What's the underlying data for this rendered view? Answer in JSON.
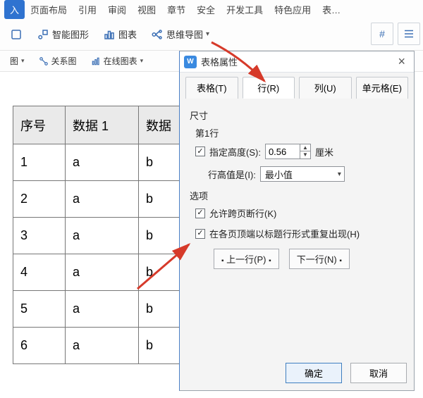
{
  "menubar": {
    "items": [
      "入",
      "页面布局",
      "引用",
      "审阅",
      "视图",
      "章节",
      "安全",
      "开发工具",
      "特色应用",
      "表…"
    ]
  },
  "ribbon": {
    "shapes": "智能图形",
    "chart": "图表",
    "mindmap": "思维导图"
  },
  "ribbon2": {
    "flow": "图",
    "relation": "关系图",
    "onlinechart": "在线图表"
  },
  "table": {
    "headers": [
      "序号",
      "数据 1",
      "数据"
    ],
    "rows": [
      {
        "n": "1",
        "d1": "a",
        "d2": "b"
      },
      {
        "n": "2",
        "d1": "a",
        "d2": "b"
      },
      {
        "n": "3",
        "d1": "a",
        "d2": "b"
      },
      {
        "n": "4",
        "d1": "a",
        "d2": "b"
      },
      {
        "n": "5",
        "d1": "a",
        "d2": "b"
      },
      {
        "n": "6",
        "d1": "a",
        "d2": "b"
      }
    ]
  },
  "dialog": {
    "title": "表格属性",
    "tabs": {
      "table": "表格(T)",
      "row": "行(R)",
      "column": "列(U)",
      "cell": "单元格(E)"
    },
    "size_section": "尺寸",
    "row_label": "第1行",
    "specify_height": "指定高度(S):",
    "height_value": "0.56",
    "height_unit": "厘米",
    "row_height_is": "行高值是(I):",
    "row_height_option": "最小值",
    "options_section": "选项",
    "allow_break": "允许跨页断行(K)",
    "repeat_header": "在各页顶端以标题行形式重复出现(H)",
    "prev_row": "上一行(P)",
    "next_row": "下一行(N)",
    "ok": "确定",
    "cancel": "取消"
  }
}
